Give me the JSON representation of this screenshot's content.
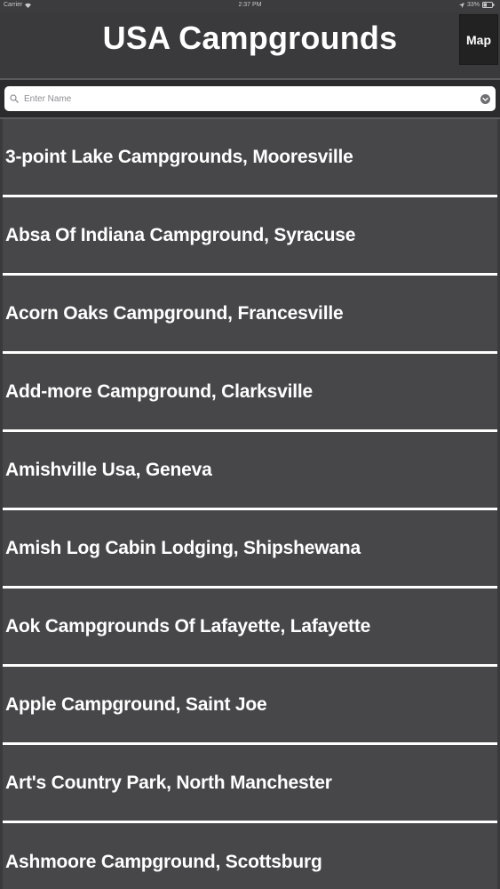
{
  "status_bar": {
    "carrier": "Carrier",
    "time": "2:37 PM",
    "battery": "33%"
  },
  "header": {
    "title": "USA Campgrounds",
    "map_button_label": "Map"
  },
  "search": {
    "placeholder": "Enter Name",
    "value": ""
  },
  "campgrounds": [
    {
      "label": "3-point Lake Campgrounds, Mooresville"
    },
    {
      "label": "Absa Of Indiana Campground, Syracuse"
    },
    {
      "label": "Acorn Oaks Campground, Francesville"
    },
    {
      "label": "Add-more Campground, Clarksville"
    },
    {
      "label": "Amishville Usa, Geneva"
    },
    {
      "label": "Amish Log Cabin Lodging, Shipshewana"
    },
    {
      "label": "Aok Campgrounds Of Lafayette, Lafayette"
    },
    {
      "label": "Apple Campground, Saint Joe"
    },
    {
      "label": "Art's Country Park, North Manchester"
    },
    {
      "label": "Ashmoore Campground, Scottsburg"
    }
  ],
  "colors": {
    "background": "#3a393b",
    "list_item": "#474649",
    "separator": "#ffffff",
    "map_button": "#232223"
  }
}
